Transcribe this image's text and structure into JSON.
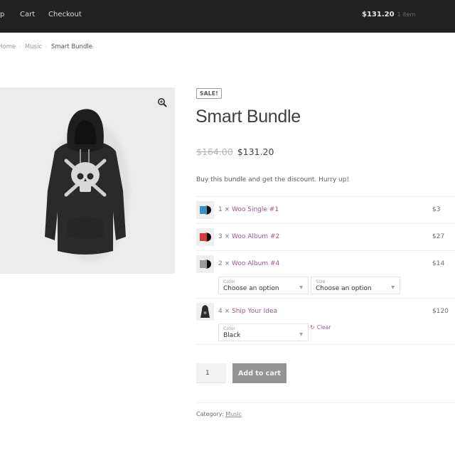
{
  "header": {
    "nav": [
      {
        "label": "p"
      },
      {
        "label": "Cart"
      },
      {
        "label": "Checkout"
      }
    ],
    "mini_cart": {
      "amount": "$131.20",
      "count": "1 item"
    }
  },
  "breadcrumb": {
    "items": [
      "Home",
      "Music"
    ],
    "separator": "›",
    "current": "Smart Bundle"
  },
  "gallery": {
    "image_alt": "Black hoodie with skull and crossbones print",
    "zoom_icon": "magnifier-plus-icon"
  },
  "product": {
    "badge": "SALE!",
    "title": "Smart Bundle",
    "regular_price": "$164.00",
    "sale_price": "$131.20",
    "short_description": "Buy this bundle and get the discount. Hurry up!"
  },
  "bundle_items": [
    {
      "qty": "1 ×",
      "name": "Woo Single #1",
      "price": "$3",
      "thumb_color": "#3a8fc4"
    },
    {
      "qty": "3 ×",
      "name": "Woo Album #2",
      "price": "$27",
      "thumb_color": "#d63a3a"
    },
    {
      "qty": "2 ×",
      "name": "Woo Album #4",
      "price": "$14",
      "thumb_color": "#8a8a8a",
      "attributes": [
        {
          "label": "Color",
          "value": "Choose an option"
        },
        {
          "label": "Size",
          "value": "Choose an option"
        }
      ]
    },
    {
      "qty": "4 ×",
      "name": "Ship Your Idea",
      "price": "$120",
      "thumb_color": "#2b2b2b",
      "attributes": [
        {
          "label": "Color",
          "value": "Black"
        }
      ],
      "clear_label": "Clear"
    }
  ],
  "cart_form": {
    "quantity": "1",
    "add_to_cart_label": "Add to cart"
  },
  "meta": {
    "category_label": "Category:",
    "category_value": "Music"
  },
  "colors": {
    "header_bg": "#222222",
    "link_accent": "#96588a",
    "button_bg": "#949494"
  }
}
